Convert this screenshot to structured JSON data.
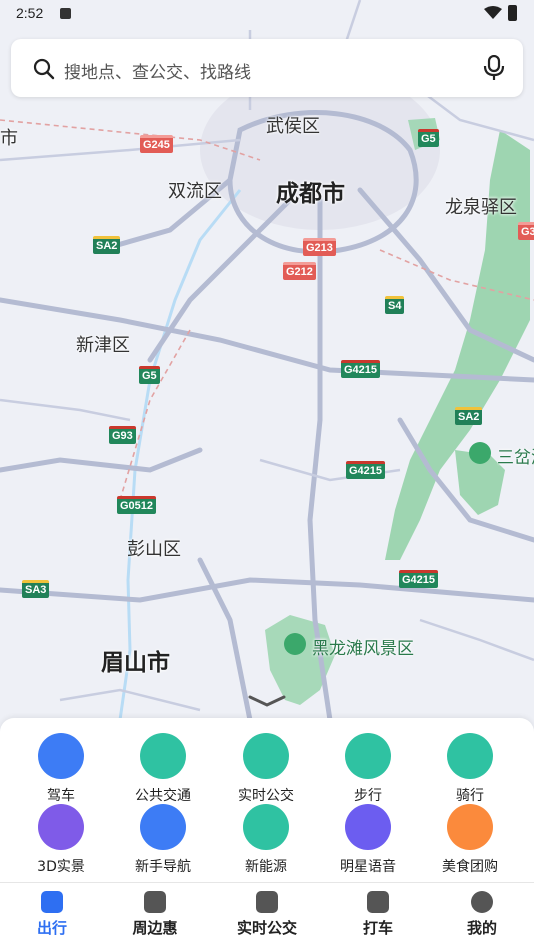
{
  "status": {
    "time": "2:52"
  },
  "search": {
    "placeholder": "搜地点、查公交、找路线"
  },
  "map": {
    "cities": [
      {
        "name": "成都市",
        "big": true
      },
      {
        "name": "武侯区"
      },
      {
        "name": "双流区"
      },
      {
        "name": "龙泉驿区"
      },
      {
        "name": "新津区"
      },
      {
        "name": "彭山区"
      },
      {
        "name": "眉山市",
        "big": true
      },
      {
        "name": "市"
      }
    ],
    "roads": [
      "G245",
      "G5",
      "SA2",
      "G213",
      "G212",
      "S4",
      "G5",
      "G4215",
      "G93",
      "SA2",
      "G4215",
      "G0512",
      "SA3",
      "G4215",
      "G3"
    ],
    "pois": [
      "三岔湖",
      "黑龙滩风景区"
    ]
  },
  "tools": [
    {
      "label": "驾车",
      "icon": "car-icon",
      "color": "#3d7cf5"
    },
    {
      "label": "公共交通",
      "icon": "bus-icon",
      "color": "#2fc2a2"
    },
    {
      "label": "实时公交",
      "icon": "realtime-bus-icon",
      "color": "#2fc2a2"
    },
    {
      "label": "步行",
      "icon": "walk-icon",
      "color": "#2fc2a2"
    },
    {
      "label": "骑行",
      "icon": "bike-icon",
      "color": "#2fc2a2"
    },
    {
      "label": "3D实景",
      "icon": "3d-globe-icon",
      "color": "#7f5be8"
    },
    {
      "label": "新手导航",
      "icon": "novice-nav-icon",
      "color": "#3d7cf5"
    },
    {
      "label": "新能源",
      "icon": "charging-icon",
      "color": "#2fc2a2"
    },
    {
      "label": "明星语音",
      "icon": "voice-icon",
      "color": "#6c5df0"
    },
    {
      "label": "美食团购",
      "icon": "food-icon",
      "color": "#fb8a3c"
    }
  ],
  "tabs": [
    {
      "label": "出行",
      "icon": "travel-icon",
      "active": true
    },
    {
      "label": "周边惠",
      "icon": "nearby-icon"
    },
    {
      "label": "实时公交",
      "icon": "bus-stop-icon"
    },
    {
      "label": "打车",
      "icon": "taxi-icon"
    },
    {
      "label": "我的",
      "icon": "profile-icon"
    }
  ],
  "colors": {
    "accent": "#2e6ff2",
    "green_zone": "#94d3a8"
  }
}
